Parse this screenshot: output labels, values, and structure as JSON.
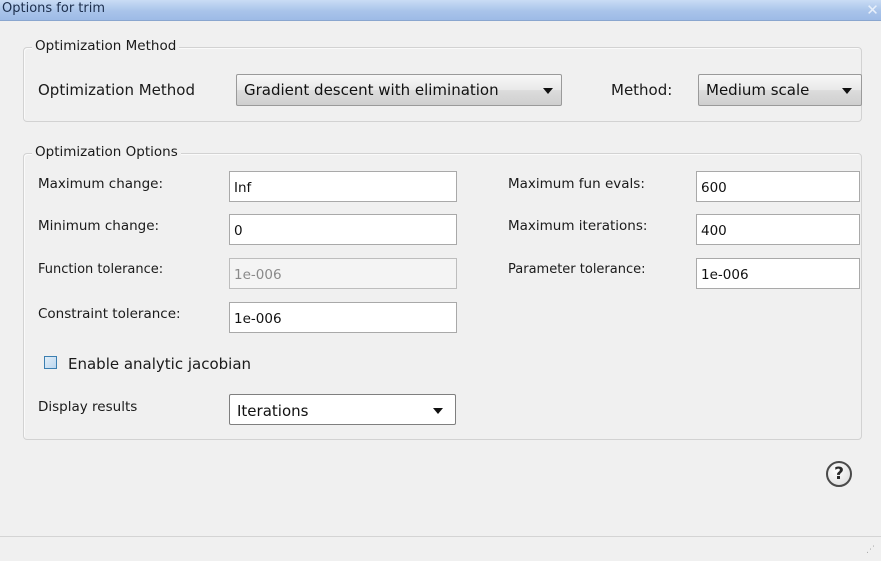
{
  "window": {
    "title": "Options for trim",
    "close_glyph": "✕"
  },
  "method_group": {
    "title": "Optimization Method",
    "label": "Optimization Method",
    "method_select_value": "Gradient descent with elimination",
    "scale_label": "Method:",
    "scale_select_value": "Medium scale"
  },
  "options_group": {
    "title": "Optimization Options",
    "max_change_label": "Maximum change:",
    "max_change_value": "Inf",
    "min_change_label": "Minimum change:",
    "min_change_value": "0",
    "func_tol_label": "Function tolerance:",
    "func_tol_value": "1e-006",
    "constraint_tol_label": "Constraint tolerance:",
    "constraint_tol_value": "1e-006",
    "max_fun_evals_label": "Maximum fun evals:",
    "max_fun_evals_value": "600",
    "max_iter_label": "Maximum iterations:",
    "max_iter_value": "400",
    "param_tol_label": "Parameter tolerance:",
    "param_tol_value": "1e-006",
    "jacobian_label": "Enable analytic jacobian",
    "jacobian_checked": false,
    "display_label": "Display results",
    "display_value": "Iterations"
  },
  "help": {
    "glyph": "?"
  },
  "icons": {
    "close": "close-icon",
    "help": "help-icon",
    "dropdown": "chevron-down-icon",
    "grip": "resize-grip-icon"
  }
}
